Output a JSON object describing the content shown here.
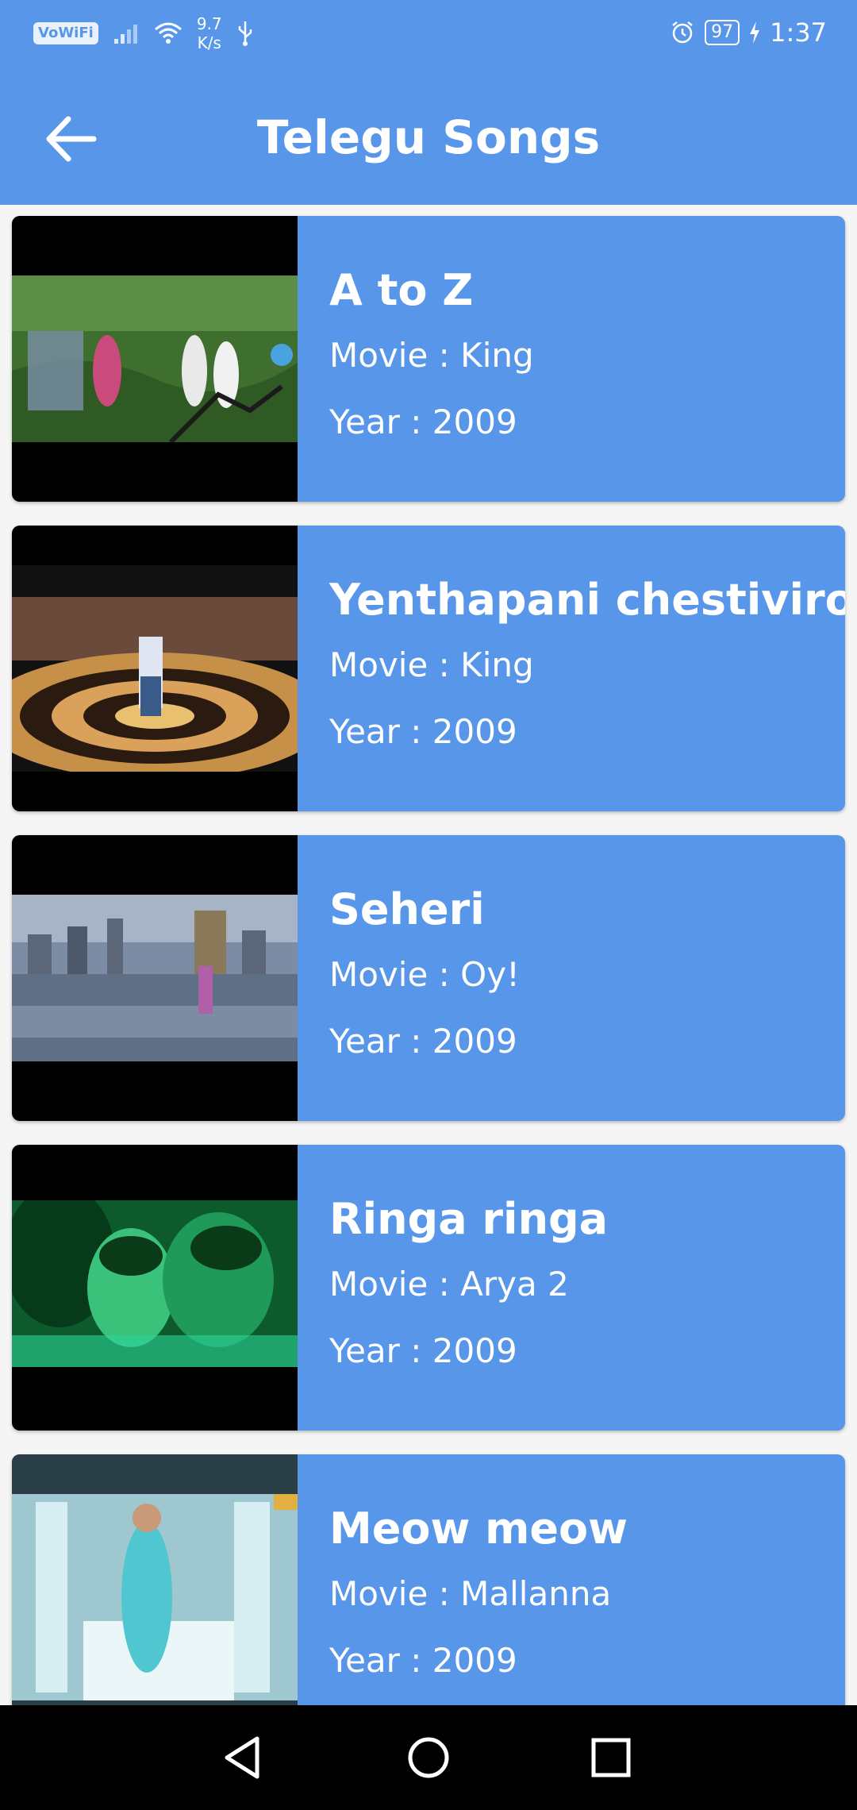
{
  "status_bar": {
    "vowifi": "VoWiFi",
    "net_speed_value": "9.7",
    "net_speed_unit": "K/s",
    "battery": "97",
    "time": "1:37"
  },
  "app_bar": {
    "title": "Telegu Songs"
  },
  "songs": [
    {
      "title": "A to Z",
      "movie": "Movie : King",
      "year": "Year : 2009"
    },
    {
      "title": "Yenthapani chestiviro",
      "movie": "Movie : King",
      "year": "Year : 2009"
    },
    {
      "title": "Seheri",
      "movie": "Movie : Oy!",
      "year": "Year : 2009"
    },
    {
      "title": "Ringa ringa",
      "movie": "Movie : Arya 2",
      "year": "Year : 2009"
    },
    {
      "title": "Meow meow",
      "movie": "Movie : Mallanna",
      "year": "Year : 2009"
    }
  ],
  "colors": {
    "primary": "#5896ea",
    "background": "#f5f5f5",
    "nav_bar": "#000000"
  },
  "icons": {
    "back": "arrow-left-icon",
    "nav_back": "triangle-back-icon",
    "nav_home": "circle-home-icon",
    "nav_recents": "square-recents-icon"
  }
}
